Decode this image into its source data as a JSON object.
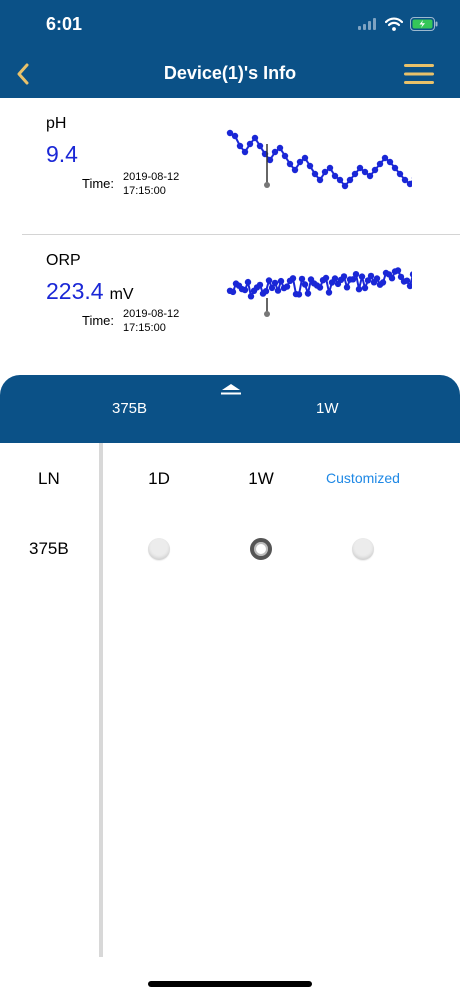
{
  "status_bar": {
    "time": "6:01"
  },
  "nav": {
    "title": "Device(1)'s Info",
    "back_icon": "chevron-left-icon",
    "menu_icon": "hamburger-menu-icon",
    "accent": "#e9c16a"
  },
  "sensors": [
    {
      "name": "pH",
      "value": "9.4",
      "unit": "",
      "time_label": "Time:",
      "date": "2019-08-12",
      "clock": "17:15:00"
    },
    {
      "name": "ORP",
      "value": "223.4",
      "unit": "mV",
      "time_label": "Time:",
      "date": "2019-08-12",
      "clock": "17:15:00"
    }
  ],
  "sheet": {
    "handle_icon": "caret-up-icon",
    "selected_ln": "375B",
    "selected_range": "1W"
  },
  "table": {
    "ln_header": "LN",
    "range_headers": [
      "1D",
      "1W",
      "Customized"
    ],
    "rows": [
      {
        "ln": "375B",
        "selected": "1W"
      }
    ]
  },
  "colors": {
    "primary": "#0b5187",
    "value_blue": "#1a27d6",
    "link_blue": "#1e88e5",
    "battery_green": "#35c759"
  }
}
